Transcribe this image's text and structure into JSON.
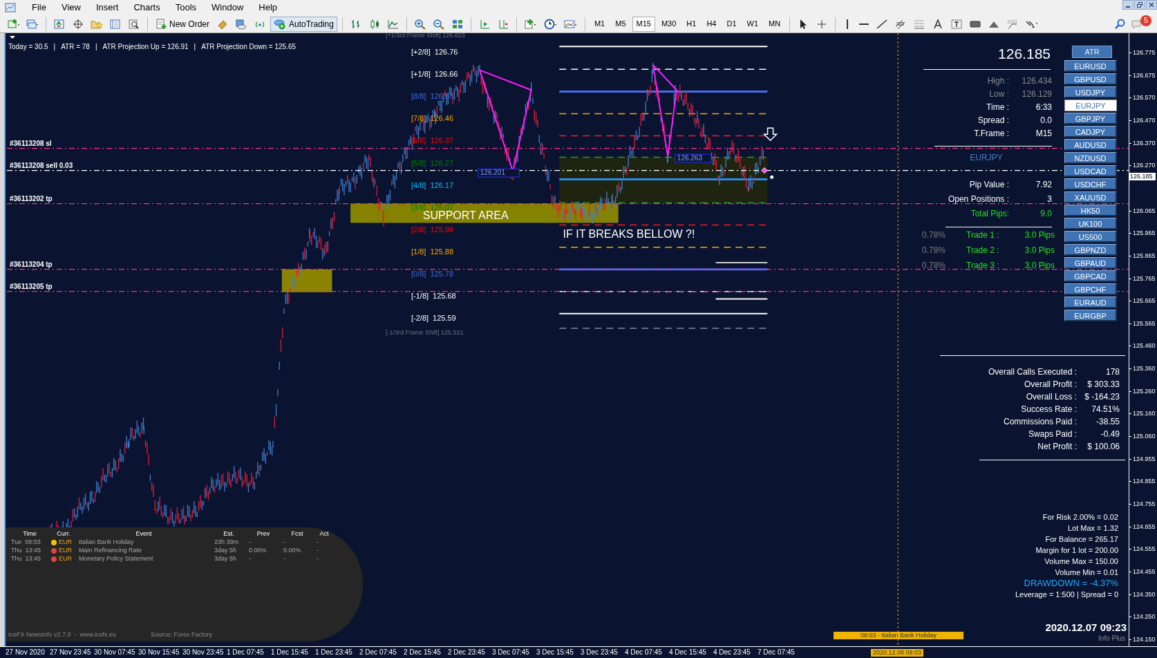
{
  "menu": [
    "File",
    "View",
    "Insert",
    "Charts",
    "Tools",
    "Window",
    "Help"
  ],
  "toolbar": {
    "new_order": "New Order",
    "autotrading": {
      "label": "AutoTrading",
      "on": true
    },
    "timeframes": [
      {
        "label": "M1",
        "selected": false
      },
      {
        "label": "M5",
        "selected": false
      },
      {
        "label": "M15",
        "selected": true
      },
      {
        "label": "M30",
        "selected": false
      },
      {
        "label": "H1",
        "selected": false
      },
      {
        "label": "H4",
        "selected": false
      },
      {
        "label": "D1",
        "selected": false
      },
      {
        "label": "W1",
        "selected": false
      },
      {
        "label": "MN",
        "selected": false
      }
    ],
    "notification_count": "5"
  },
  "chart": {
    "info_line": [
      "Today = 30.5",
      "|",
      "ATR = 78",
      "|",
      "ATR Projection Up = 126.91",
      "|",
      "ATR Projection Down = 125.65"
    ],
    "frame_shift_labels": [
      {
        "label": "[+1/3rd Frame Shift]",
        "value": "126.823"
      },
      {
        "label": "[-1/3rd Frame Shift]",
        "value": "125.521"
      }
    ],
    "murrey_levels": [
      {
        "label": "[+2/8]",
        "value": "126.76",
        "color": "#ffffff"
      },
      {
        "label": "[+1/8]",
        "value": "126.66",
        "color": "#ffffff"
      },
      {
        "label": "[8/8]",
        "value": "126.56",
        "color": "#4169e1"
      },
      {
        "label": "[7/8]",
        "value": "126.46",
        "color": "#ffa500"
      },
      {
        "label": "[6/8]",
        "value": "126.37",
        "color": "#ff0000"
      },
      {
        "label": "[5/8]",
        "value": "126.27",
        "color": "#008000"
      },
      {
        "label": "[4/8]",
        "value": "126.17",
        "color": "#00bfff"
      },
      {
        "label": "[3/8]",
        "value": "126.07",
        "color": "#008000"
      },
      {
        "label": "[2/8]",
        "value": "125.98",
        "color": "#ff0000"
      },
      {
        "label": "[1/8]",
        "value": "125.88",
        "color": "#ffa500"
      },
      {
        "label": "[0/8]",
        "value": "125.78",
        "color": "#4169e1"
      },
      {
        "label": "[-1/8]",
        "value": "125.68",
        "color": "#ffffff"
      },
      {
        "label": "[-2/8]",
        "value": "125.59",
        "color": "#ffffff"
      }
    ],
    "order_lines": [
      {
        "label": "#36113208 sl",
        "kind": "stop"
      },
      {
        "label": "#36113208 sell 0.03",
        "kind": "entry"
      },
      {
        "label": "#36113202 tp",
        "kind": "target"
      },
      {
        "label": "#36113204 tp",
        "kind": "target"
      },
      {
        "label": "#36113205 tp",
        "kind": "target"
      }
    ],
    "support_label": "SUPPORT AREA",
    "note": "IF IT BREAKS BELLOW ?!",
    "price_boxes": [
      "126.201",
      "126.263"
    ]
  },
  "info_panel": {
    "atr_button": "ATR",
    "price": "126.185",
    "quote_rows": [
      {
        "label": "High :",
        "value": "126.434",
        "dim": true
      },
      {
        "label": "Low :",
        "value": "126.129",
        "dim": true
      },
      {
        "label": "Time :",
        "value": "6:33",
        "dim": false
      },
      {
        "label": "Spread :",
        "value": "0.0",
        "dim": false
      },
      {
        "label": "T.Frame :",
        "value": "M15",
        "dim": false
      }
    ],
    "symbol": "EURJPY",
    "position_rows": [
      {
        "label": "Pip Value :",
        "value": "7.92",
        "highlight": false
      },
      {
        "label": "Open Positions :",
        "value": "3",
        "highlight": false
      },
      {
        "label": "Total Pips:",
        "value": "9.0",
        "highlight": true
      }
    ],
    "trades": [
      {
        "percent": "0.78%",
        "label": "Trade 1 :",
        "value": "3.0 Pips"
      },
      {
        "percent": "0.78%",
        "label": "Trade 2 :",
        "value": "3.0 Pips"
      },
      {
        "percent": "0.78%",
        "label": "Trade 3 :",
        "value": "3.0 Pips"
      }
    ]
  },
  "symbols": [
    {
      "label": "EURUSD",
      "selected": false
    },
    {
      "label": "GBPUSD",
      "selected": false
    },
    {
      "label": "USDJPY",
      "selected": false
    },
    {
      "label": "EURJPY",
      "selected": true
    },
    {
      "label": "GBPJPY",
      "selected": false
    },
    {
      "label": "CADJPY",
      "selected": false
    },
    {
      "label": "AUDUSD",
      "selected": false
    },
    {
      "label": "NZDUSD",
      "selected": false
    },
    {
      "label": "USDCAD",
      "selected": false
    },
    {
      "label": "USDCHF",
      "selected": false
    },
    {
      "label": "XAUUSD",
      "selected": false
    },
    {
      "label": "HK50",
      "selected": false
    },
    {
      "label": "UK100",
      "selected": false
    },
    {
      "label": "US500",
      "selected": false
    },
    {
      "label": "GBPNZD",
      "selected": false
    },
    {
      "label": "GBPAUD",
      "selected": false
    },
    {
      "label": "GBPCAD",
      "selected": false
    },
    {
      "label": "GBPCHF",
      "selected": false
    },
    {
      "label": "EURAUD",
      "selected": false
    },
    {
      "label": "EURGBP",
      "selected": false
    }
  ],
  "statistics": [
    {
      "label": "Overall Calls Executed :",
      "value": "178"
    },
    {
      "label": "Overall Profit :",
      "value": "$ 303.33"
    },
    {
      "label": "Overall Loss :",
      "value": "$ -164.23"
    },
    {
      "label": "Success Rate :",
      "value": "74.51%"
    },
    {
      "label": "Commissions Paid :",
      "value": "-38.55"
    },
    {
      "label": "Swaps Paid :",
      "value": "-0.49"
    },
    {
      "label": "Net Profit :",
      "value": "$ 100.06"
    }
  ],
  "risk_lines": [
    {
      "text": "For Risk 2.00% = 0.02",
      "kind": "plain"
    },
    {
      "text": "Lot Max = 1.32",
      "kind": "plain"
    },
    {
      "text": "For Balance = 265.17",
      "kind": "plain"
    },
    {
      "text": "Margin for 1 lot = 200.00",
      "kind": "plain"
    },
    {
      "text": "Volume Max = 150.00",
      "kind": "plain"
    },
    {
      "text": "Volume Min = 0.01",
      "kind": "plain"
    },
    {
      "text": "DRAWDOWN = -4.37%",
      "kind": "alert"
    },
    {
      "text": "Leverage = 1:500 | Spread = 0",
      "kind": "plain"
    }
  ],
  "datetime": "2020.12.07 09:23",
  "datetime_caption": "Info Plus",
  "news": {
    "columns": [
      "Time",
      "Curr.",
      "Event",
      "Est.",
      "Prev",
      "Fcst",
      "Act"
    ],
    "rows": [
      {
        "time": "Tue  08:03",
        "color": "#f5c400",
        "currency": "EUR",
        "event": "Italian Bank Holiday",
        "est": "23h 39m",
        "prev": "-",
        "fcst": "-",
        "act": "-"
      },
      {
        "time": "Thu  13:45",
        "color": "#e0463c",
        "currency": "EUR",
        "event": "Main Refinancing Rate",
        "est": "3day 5h",
        "prev": "0.00%",
        "fcst": "0.00%",
        "act": "-"
      },
      {
        "time": "Thu  13:45",
        "color": "#e0463c",
        "currency": "EUR",
        "event": "Monetary Policy Statement",
        "est": "3day 5h",
        "prev": "-",
        "fcst": "-",
        "act": "-"
      }
    ],
    "footer": "IceFX NewsInfo v2.7.0  -  www.icefx.eu",
    "source": "Source: Forex Factory"
  },
  "event_bar": "08:03 - Italian Bank Holiday",
  "price_axis": [
    "126.775",
    "126.675",
    "126.570",
    "126.470",
    "126.370",
    "126.270",
    "126.065",
    "125.965",
    "125.865",
    "125.765",
    "125.665",
    "125.565",
    "125.460",
    "125.360",
    "125.260",
    "125.160",
    "125.060",
    "124.955",
    "124.855",
    "124.755",
    "124.655",
    "124.555",
    "124.455",
    "124.350",
    "124.250",
    "124.150"
  ],
  "current_price_tag": "126.185",
  "time_axis": [
    "27 Nov 2020",
    "27 Nov 23:45",
    "30 Nov 07:45",
    "30 Nov 15:45",
    "30 Nov 23:45",
    "1 Dec 07:45",
    "1 Dec 15:45",
    "1 Dec 23:45",
    "2 Dec 07:45",
    "2 Dec 15:45",
    "2 Dec 23:45",
    "3 Dec 07:45",
    "3 Dec 15:45",
    "3 Dec 23:45",
    "4 Dec 07:45",
    "4 Dec 15:45",
    "4 Dec 23:45",
    "7 Dec 07:45"
  ],
  "time_axis_marker": "2020.12.08 09:03"
}
